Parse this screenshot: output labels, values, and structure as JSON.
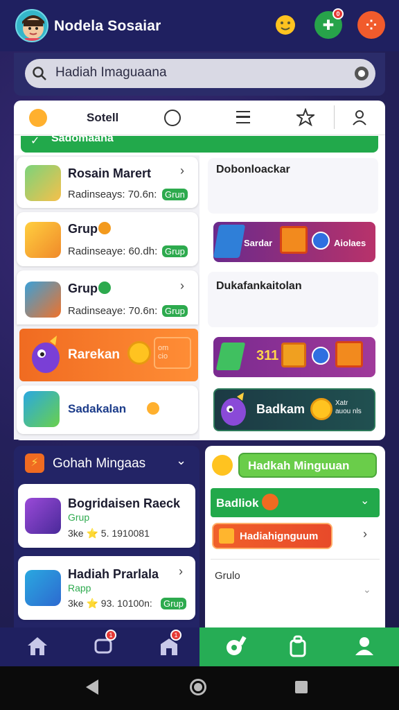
{
  "header": {
    "title": "Nodela Sosaiar",
    "icons": [
      "avatar",
      "emoji-icon",
      "tools-icon",
      "menu-icon"
    ],
    "notification_count": "0"
  },
  "search": {
    "value": "Hadiah Imaguaana"
  },
  "tabs": {
    "label": "Sotell"
  },
  "strip": {
    "label": "Sadomaana"
  },
  "left_list": [
    {
      "title": "Rosain Marert",
      "sub": "Radinseays: 70.6n:",
      "pill": "Grun"
    },
    {
      "title": "Grup",
      "sub": "Radinseaye: 60.dh:",
      "pill": "Grup"
    },
    {
      "title": "Grup",
      "sub": "Radinseaye: 70.6n:",
      "pill": "Grup"
    }
  ],
  "promo_orange": {
    "label": "Rarekan",
    "badge": "om\ncio"
  },
  "list_last": {
    "title": "Sadakalan"
  },
  "right": {
    "section1": "Dobonloackar",
    "banner1_left": "Sardar",
    "banner1_right": "Aiolaes",
    "section2": "Dukafankaitolan",
    "banner2_text": "311",
    "banner3_text": "Badkam",
    "banner3_small": "Xatr\nauou nls"
  },
  "lower_left": {
    "title": "Gohah Mingaas",
    "items": [
      {
        "title": "Bogridaisen Raeck",
        "sub": "Grup",
        "meta": "3ke ⭐ 5. 1910081"
      },
      {
        "title": "Hadiah Prarlala",
        "sub": "Rapp",
        "meta": "3ke ⭐ 93. 10100n:",
        "pill": "Grup"
      }
    ]
  },
  "lower_right": {
    "button1": "Hadkah Minguuan",
    "row_label": "Badliok",
    "button2": "Hadiahignguum",
    "row3": "Grulo"
  },
  "colors": {
    "navy": "#1f2060",
    "green": "#26ad55",
    "orange": "#f06b21",
    "purple": "#8b2b8b"
  }
}
